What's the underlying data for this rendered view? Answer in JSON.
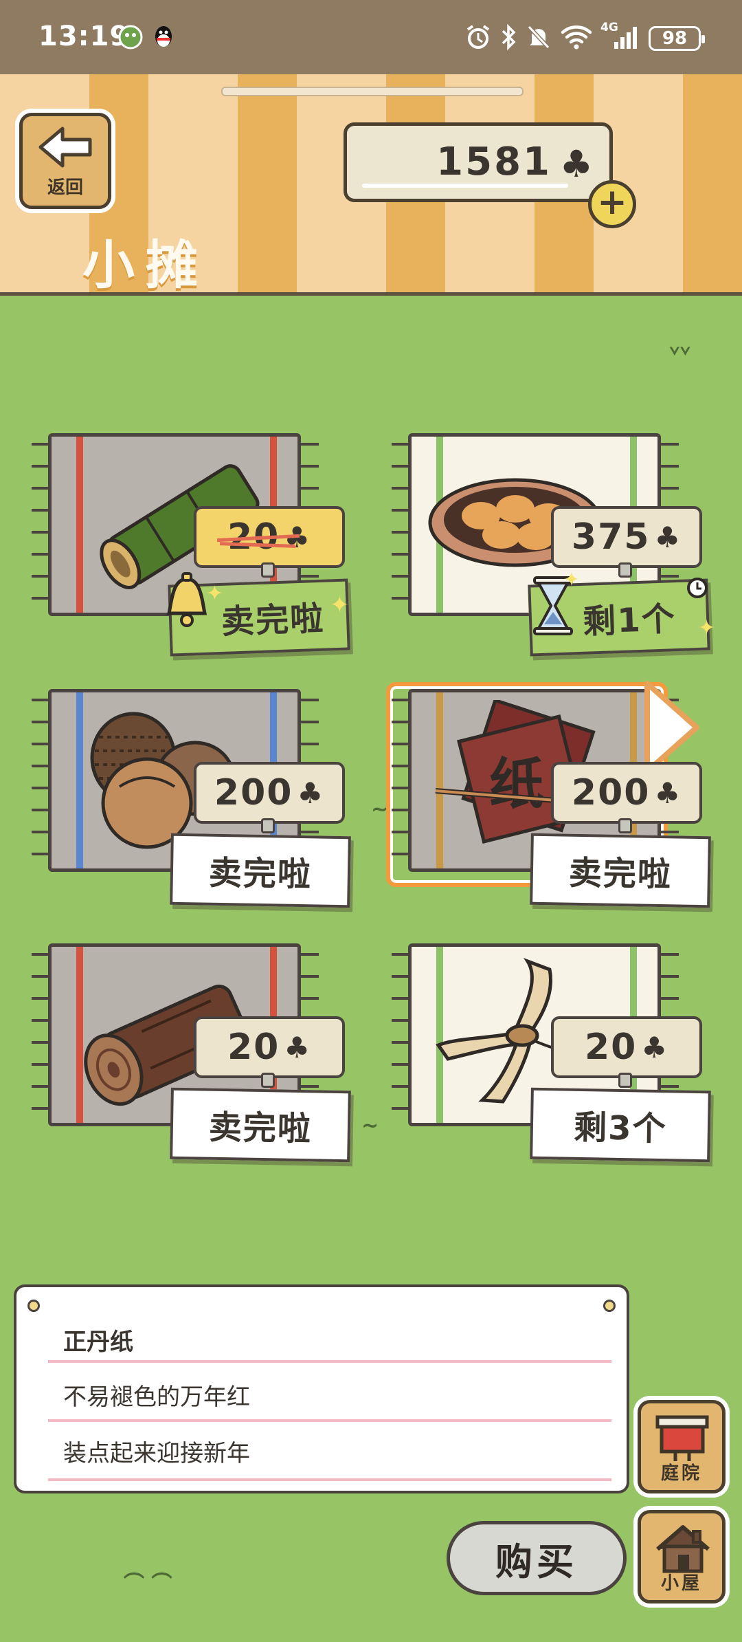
{
  "status_bar": {
    "time": "13:19",
    "battery": "98",
    "network": "4G"
  },
  "header": {
    "back_label": "返回",
    "coins": "1581",
    "coin_icon": "clover-icon",
    "title": "小摊"
  },
  "stalls": [
    {
      "price": "20",
      "status": "卖完啦",
      "status_style": "sold-out-bell",
      "price_struck": true,
      "item": "bamboo"
    },
    {
      "price": "375",
      "status": "剩1个",
      "status_style": "limited-timer",
      "price_struck": false,
      "item": "dumplings"
    },
    {
      "price": "200",
      "status": "卖完啦",
      "status_style": "plain",
      "price_struck": false,
      "item": "chestnuts"
    },
    {
      "price": "200",
      "status": "卖完啦",
      "status_style": "plain",
      "price_struck": false,
      "item": "red-paper",
      "selected": true
    },
    {
      "price": "20",
      "status": "卖完啦",
      "status_style": "plain",
      "price_struck": false,
      "item": "log"
    },
    {
      "price": "20",
      "status": "剩3个",
      "status_style": "plain",
      "price_struck": false,
      "item": "bundle"
    }
  ],
  "info": {
    "name": "正丹纸",
    "line1": "不易褪色的万年红",
    "line2": "装点起来迎接新年"
  },
  "side_buttons": {
    "yard": "庭院",
    "house": "小屋"
  },
  "buy_label": "购买",
  "colors": {
    "grass": "#97c464",
    "selection": "#f39a3d",
    "sold_tag_green": "#a9d06a"
  }
}
